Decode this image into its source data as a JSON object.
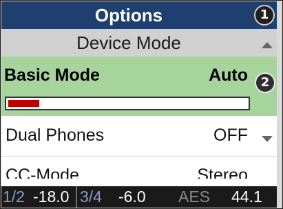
{
  "header": {
    "title": "Options"
  },
  "section": {
    "title": "Device Mode",
    "scroll_up_icon": "triangle-up"
  },
  "selected_row": {
    "label": "Basic Mode",
    "value": "Auto",
    "level": 0.13
  },
  "rows": [
    {
      "label": "Dual Phones",
      "value": "OFF",
      "scroll_down_icon": "triangle-down"
    },
    {
      "label": "CC-Mode",
      "value": "Stereo"
    }
  ],
  "status_bar": {
    "ch12_label": "1/2",
    "ch12_value": "-18.0",
    "ch34_label": "3/4",
    "ch34_value": "-6.0",
    "format_label": "AES",
    "rate_value": "44.1"
  },
  "badges": {
    "one": "1",
    "two": "2"
  },
  "colors": {
    "title_bg": "#1f3f6e",
    "section_bg": "#d0d0d0",
    "selected_bg": "#a7d39c",
    "level_fill": "#c00000",
    "status_bg": "#1a1a1a"
  }
}
